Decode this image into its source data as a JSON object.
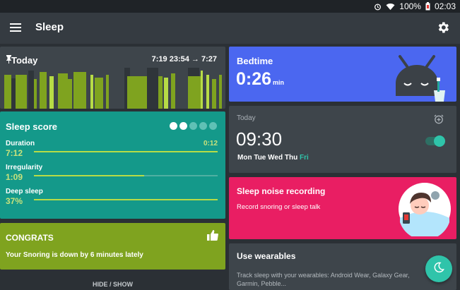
{
  "status_bar": {
    "battery": "100%",
    "time": "02:03"
  },
  "app_bar": {
    "title": "Sleep"
  },
  "today_card": {
    "title": "Today",
    "range": "7:19 23:54 → 7:27",
    "colors": {
      "light": "#7fa31f",
      "bright": "#b7dc46"
    }
  },
  "sleep_score": {
    "title": "Sleep score",
    "dots_filled": 2,
    "dots_total": 5,
    "metrics": [
      {
        "label": "Duration",
        "value": "7:12",
        "right": "0:12",
        "fraction": 1.0
      },
      {
        "label": "Irregularity",
        "value": "1:09",
        "right": "",
        "fraction": 0.6
      },
      {
        "label": "Deep sleep",
        "value": "37%",
        "right": "",
        "fraction": 1.0
      }
    ]
  },
  "congrats": {
    "title": "CONGRATS",
    "message": "Your Snoring is down by 6 minutes lately",
    "hide_show": "HIDE / SHOW"
  },
  "bedtime": {
    "title": "Bedtime",
    "value": "0:26",
    "unit": "min",
    "color": "#4b67f0"
  },
  "alarm": {
    "label": "Today",
    "time": "09:30",
    "days": [
      "Mon",
      "Tue",
      "Wed",
      "Thu"
    ],
    "highlight_day": "Fri",
    "enabled": true
  },
  "noise": {
    "title": "Sleep noise recording",
    "subtitle": "Record snoring or sleep talk",
    "color": "#e91e63"
  },
  "wearables": {
    "title": "Use wearables",
    "subtitle": "Track sleep with your wearables: Android Wear, Galaxy Gear, Garmin, Pebble..."
  },
  "fab": {
    "icon": "moon-icon"
  }
}
